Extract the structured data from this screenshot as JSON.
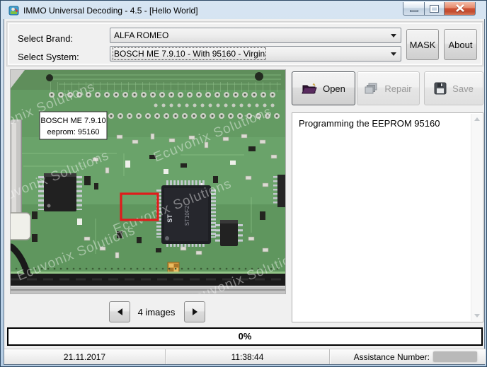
{
  "window": {
    "title": "IMMO Universal Decoding - 4.5 - [Hello World]"
  },
  "selectors": {
    "brand_label": "Select Brand:",
    "brand_value": "ALFA ROMEO",
    "system_label": "Select System:",
    "system_value": "BOSCH ME 7.9.10 - With 95160 - Virgin",
    "mask_button": "MASK",
    "about_button": "About"
  },
  "pcb": {
    "watermark": "Ecuvonix Solutions",
    "label_line1": "BOSCH ME 7.9.10",
    "label_line2": "eeprom: 95160",
    "st_logo": "ST",
    "mcu_text": "ST10F2"
  },
  "nav": {
    "count_label": "4 images"
  },
  "actions": {
    "open_label": "Open",
    "repair_label": "Repair",
    "save_label": "Save"
  },
  "log": {
    "text": "Programming the EEPROM 95160"
  },
  "progress": {
    "value": "0%"
  },
  "status": {
    "date": "21.11.2017",
    "time": "11:38:44",
    "assistance_label": "Assistance Number:"
  },
  "colors": {
    "highlight_red": "#e01b1b",
    "pcb_green": "#649b63",
    "close_button_red": "#ce5234"
  }
}
